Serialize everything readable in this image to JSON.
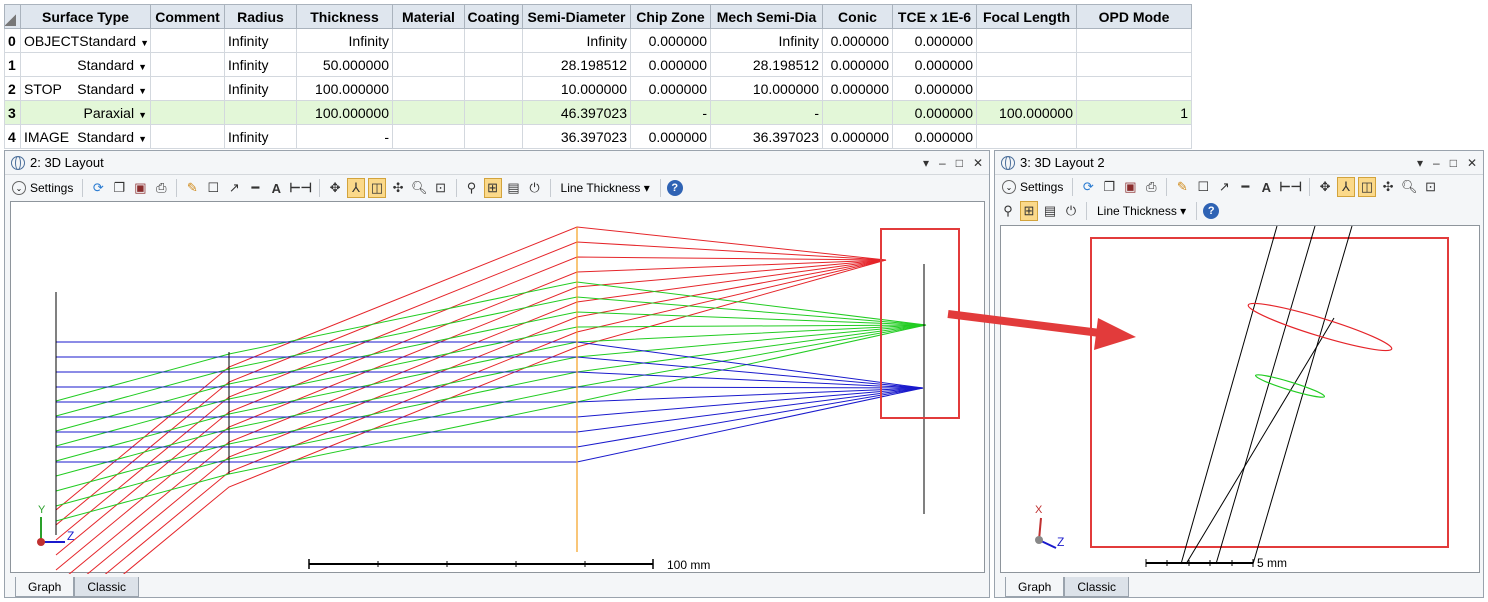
{
  "table": {
    "headers": [
      "Surface Type",
      "Comment",
      "Radius",
      "Thickness",
      "Material",
      "Coating",
      "Semi-Diameter",
      "Chip Zone",
      "Mech Semi-Dia",
      "Conic",
      "TCE x 1E-6",
      "Focal Length",
      "OPD Mode"
    ],
    "rows": [
      {
        "idx": "0",
        "label": "OBJECT",
        "type": "Standard",
        "radius": "Infinity",
        "thickness": "Infinity",
        "semi_diameter": "Infinity",
        "chip_zone": "0.000000",
        "mech_semi_dia": "Infinity",
        "conic": "0.000000",
        "tce": "0.000000",
        "focal_length": "",
        "opd_mode": ""
      },
      {
        "idx": "1",
        "label": "",
        "type": "Standard",
        "radius": "Infinity",
        "thickness": "50.000000",
        "semi_diameter": "28.198512",
        "chip_zone": "0.000000",
        "mech_semi_dia": "28.198512",
        "conic": "0.000000",
        "tce": "0.000000",
        "focal_length": "",
        "opd_mode": ""
      },
      {
        "idx": "2",
        "label": "STOP",
        "type": "Standard",
        "radius": "Infinity",
        "thickness": "100.000000",
        "semi_diameter": "10.000000",
        "chip_zone": "0.000000",
        "mech_semi_dia": "10.000000",
        "conic": "0.000000",
        "tce": "0.000000",
        "focal_length": "",
        "opd_mode": ""
      },
      {
        "idx": "3",
        "label": "",
        "type": "Paraxial",
        "radius": "",
        "thickness": "100.000000",
        "semi_diameter": "46.397023",
        "chip_zone": "-",
        "mech_semi_dia": "-",
        "conic": "",
        "tce": "0.000000",
        "focal_length": "100.000000",
        "opd_mode": "1"
      },
      {
        "idx": "4",
        "label": "IMAGE",
        "type": "Standard",
        "radius": "Infinity",
        "thickness": "-",
        "semi_diameter": "36.397023",
        "chip_zone": "0.000000",
        "mech_semi_dia": "36.397023",
        "conic": "0.000000",
        "tce": "0.000000",
        "focal_length": "",
        "opd_mode": ""
      }
    ]
  },
  "panel_left": {
    "title": "2: 3D Layout",
    "settings_label": "Settings",
    "line_thickness_label": "Line Thickness",
    "scale_label": "100 mm",
    "axis_y": "Y",
    "axis_z": "Z",
    "tabs": [
      "Graph",
      "Classic"
    ]
  },
  "panel_right": {
    "title": "3: 3D Layout 2",
    "settings_label": "Settings",
    "line_thickness_label": "Line Thickness",
    "scale_label": "5 mm",
    "axis_x": "X",
    "axis_z": "Z",
    "tabs": [
      "Graph",
      "Classic"
    ]
  },
  "window_buttons": [
    "▾",
    "–",
    "□",
    "✕"
  ],
  "colors": {
    "ray_red": "#e5252a",
    "ray_green": "#22cc22",
    "ray_blue": "#1a1acc",
    "stop_orange": "#f5a020",
    "highlight_box": "#e23b3b",
    "arrow": "#e23b3b",
    "row_highlight": "#e3f7d8"
  }
}
